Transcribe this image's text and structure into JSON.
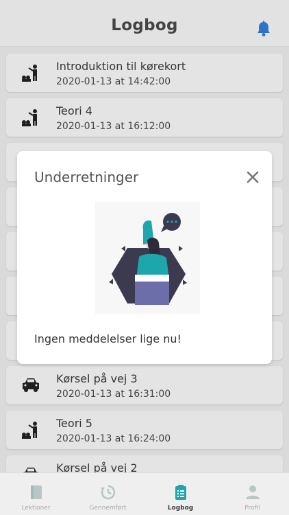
{
  "header": {
    "title": "Logbog",
    "icon": "bell-icon"
  },
  "lessons": [
    {
      "icon": "teacher-icon",
      "title": "Introduktion til kørekort",
      "date": "2020-01-13 at 14:42:00"
    },
    {
      "icon": "teacher-icon",
      "title": "Teori 4",
      "date": "2020-01-13 at 16:12:00"
    },
    {
      "icon": "car-icon",
      "title": "Kørsel på vej 3",
      "date": "2020-01-13 at 16:31:00"
    },
    {
      "icon": "teacher-icon",
      "title": "Teori 5",
      "date": "2020-01-13 at 16:24:00"
    },
    {
      "icon": "car-icon",
      "title": "Kørsel på vej 2",
      "date": ""
    }
  ],
  "modal": {
    "title": "Underretninger",
    "message": "Ingen meddelelser lige nu!",
    "close_icon": "close-icon"
  },
  "tabs": [
    {
      "label": "Lektioner",
      "icon": "book-icon",
      "active": false
    },
    {
      "label": "Gennemført",
      "icon": "history-icon",
      "active": false
    },
    {
      "label": "Logbog",
      "icon": "clipboard-list-icon",
      "active": true
    },
    {
      "label": "Profil",
      "icon": "user-icon",
      "active": false
    }
  ],
  "colors": {
    "accent": "#1ea6ad",
    "inactive_tab": "#b9c6c6",
    "bell": "#2f7fd7"
  }
}
